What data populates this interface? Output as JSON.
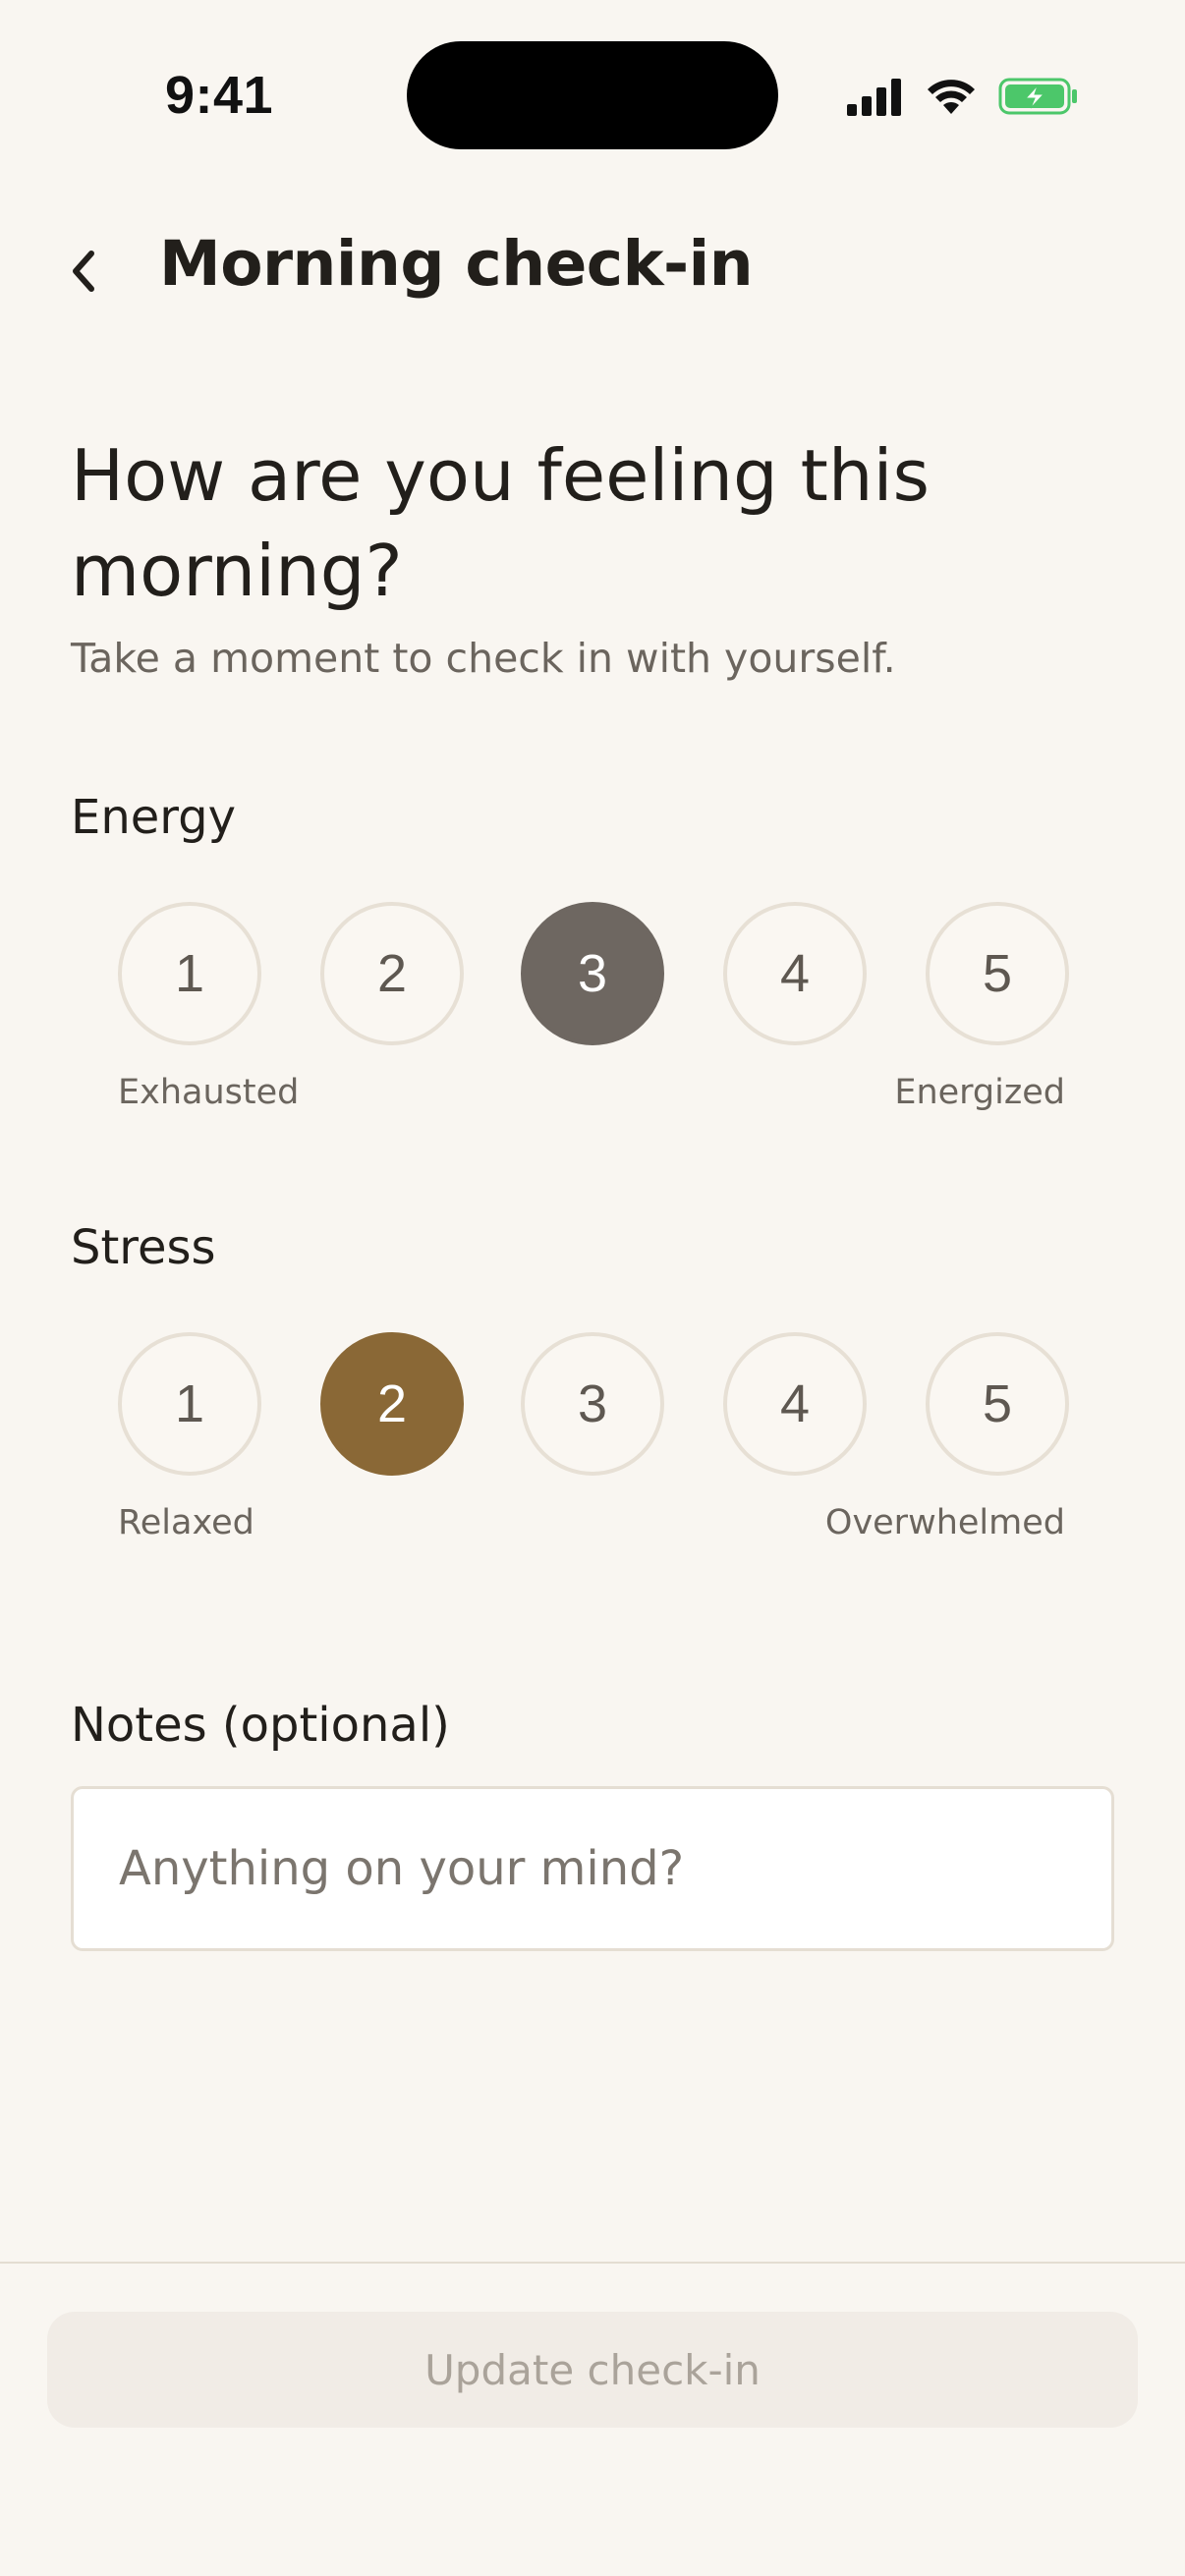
{
  "status_bar": {
    "time": "9:41",
    "icons": [
      "signal-icon",
      "wifi-icon",
      "battery-charging-icon"
    ]
  },
  "header": {
    "back_icon": "chevron-left-icon",
    "title": "Morning check-in"
  },
  "question": {
    "title": "How are you feeling this morning?",
    "subtitle": "Take a moment to check in with yourself."
  },
  "energy": {
    "label": "Energy",
    "options": [
      "1",
      "2",
      "3",
      "4",
      "5"
    ],
    "selected": "3",
    "low_label": "Exhausted",
    "high_label": "Energized"
  },
  "stress": {
    "label": "Stress",
    "options": [
      "1",
      "2",
      "3",
      "4",
      "5"
    ],
    "selected": "2",
    "low_label": "Relaxed",
    "high_label": "Overwhelmed"
  },
  "notes": {
    "label": "Notes (optional)",
    "placeholder": "Anything on your mind?",
    "value": ""
  },
  "footer": {
    "button_label": "Update check-in"
  },
  "colors": {
    "background": "#f9f6f1",
    "energy_selected": "#6e6761",
    "stress_selected": "#8a6836",
    "battery_green": "#4cc76a"
  }
}
